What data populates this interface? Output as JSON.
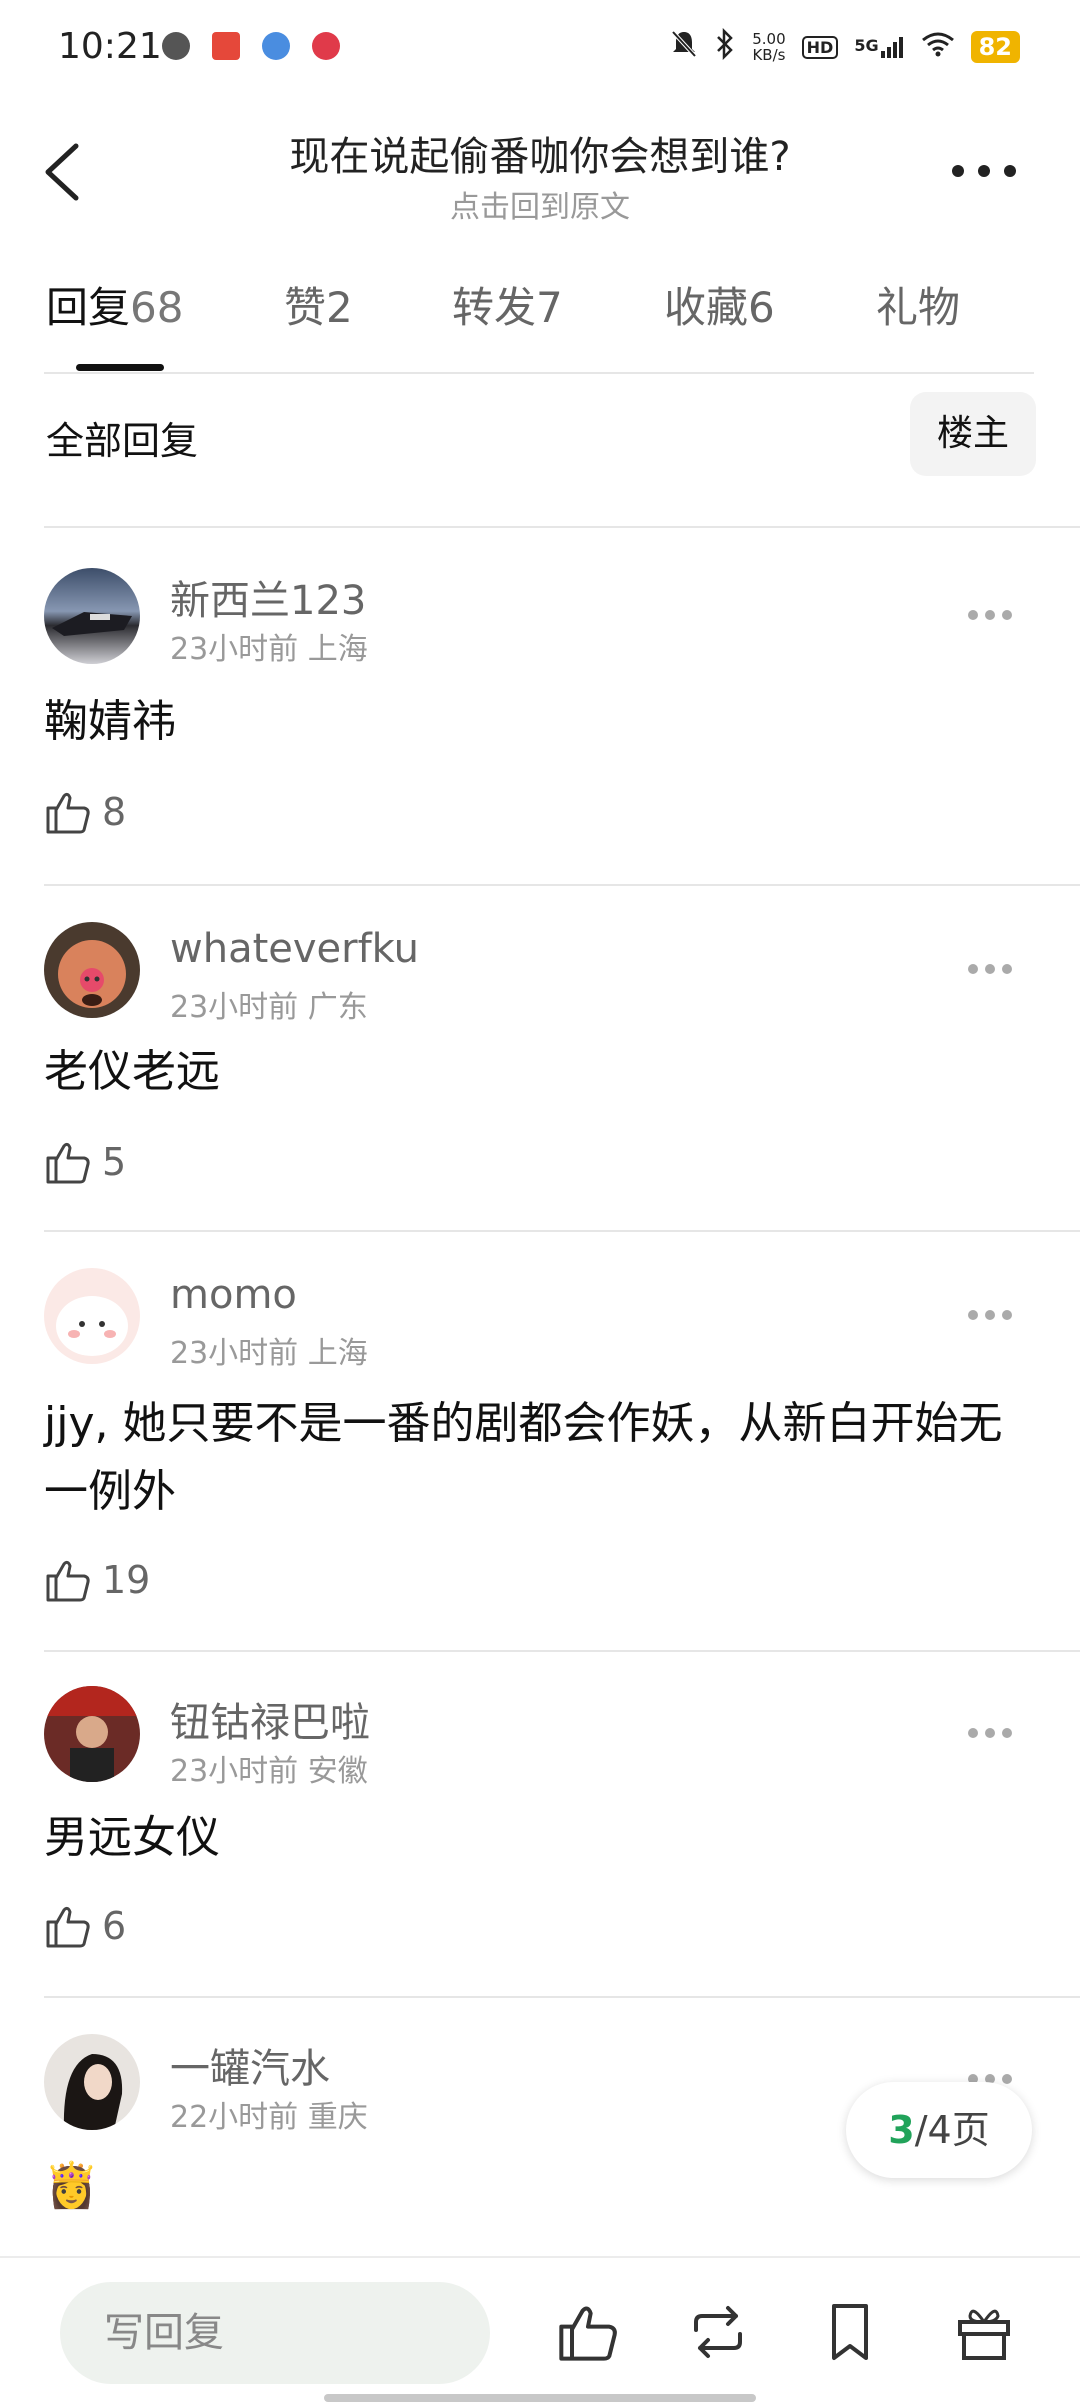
{
  "status_bar": {
    "time": "10:21",
    "net_speed_value": "5.00",
    "net_speed_unit": "KB/s",
    "hd": "HD",
    "signal": "5G",
    "battery": "82"
  },
  "header": {
    "title": "现在说起偷番咖你会想到谁?",
    "subtitle": "点击回到原文"
  },
  "tabs": [
    {
      "label": "回复",
      "count": "68"
    },
    {
      "label": "赞",
      "count": "2"
    },
    {
      "label": "转发",
      "count": "7"
    },
    {
      "label": "收藏",
      "count": "6"
    },
    {
      "label": "礼物",
      "count": ""
    }
  ],
  "filter": {
    "label": "全部回复",
    "owner_button": "楼主"
  },
  "comments": [
    {
      "username": "新西兰123",
      "time": "23小时前",
      "location": "上海",
      "text": "鞠婧祎",
      "likes": "8"
    },
    {
      "username": "whateverfku",
      "time": "23小时前",
      "location": "广东",
      "text": "老仪老远",
      "likes": "5"
    },
    {
      "username": "momo",
      "time": "23小时前",
      "location": "上海",
      "text": "jjy, 她只要不是一番的剧都会作妖，从新白开始无一例外",
      "likes": "19"
    },
    {
      "username": "钮钴禄巴啦",
      "time": "23小时前",
      "location": "安徽",
      "text": "男远女仪",
      "likes": "6"
    },
    {
      "username": "一罐汽水",
      "time": "22小时前",
      "location": "重庆",
      "text": "👸",
      "likes": ""
    }
  ],
  "pager": {
    "current": "3",
    "total_label": "/4页"
  },
  "bottom_bar": {
    "reply_placeholder": "写回复",
    "icons": [
      "like-icon",
      "repost-icon",
      "bookmark-icon",
      "gift-icon"
    ]
  },
  "colors": {
    "accent": "#21a35a",
    "battery": "#f0b400"
  }
}
